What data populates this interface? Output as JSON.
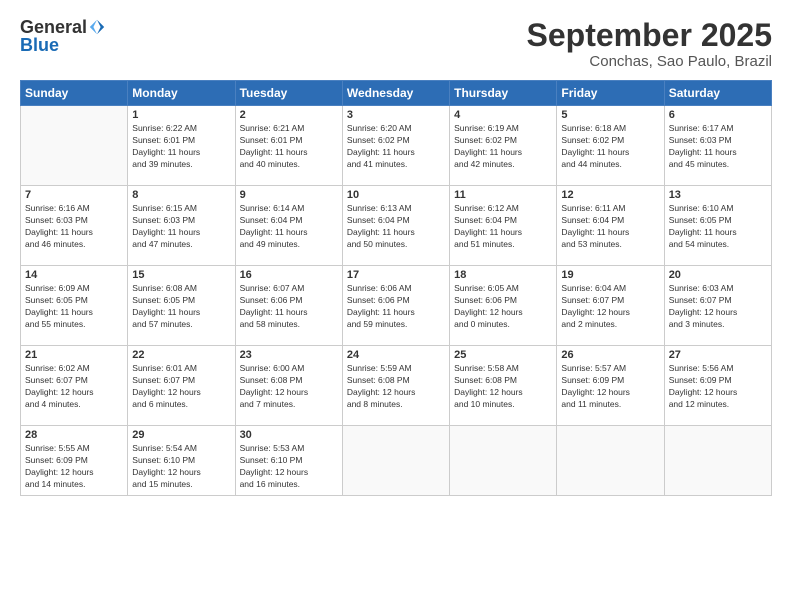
{
  "header": {
    "logo_general": "General",
    "logo_blue": "Blue",
    "month_title": "September 2025",
    "location": "Conchas, Sao Paulo, Brazil"
  },
  "days_of_week": [
    "Sunday",
    "Monday",
    "Tuesday",
    "Wednesday",
    "Thursday",
    "Friday",
    "Saturday"
  ],
  "weeks": [
    [
      {
        "day": "",
        "content": ""
      },
      {
        "day": "1",
        "content": "Sunrise: 6:22 AM\nSunset: 6:01 PM\nDaylight: 11 hours\nand 39 minutes."
      },
      {
        "day": "2",
        "content": "Sunrise: 6:21 AM\nSunset: 6:01 PM\nDaylight: 11 hours\nand 40 minutes."
      },
      {
        "day": "3",
        "content": "Sunrise: 6:20 AM\nSunset: 6:02 PM\nDaylight: 11 hours\nand 41 minutes."
      },
      {
        "day": "4",
        "content": "Sunrise: 6:19 AM\nSunset: 6:02 PM\nDaylight: 11 hours\nand 42 minutes."
      },
      {
        "day": "5",
        "content": "Sunrise: 6:18 AM\nSunset: 6:02 PM\nDaylight: 11 hours\nand 44 minutes."
      },
      {
        "day": "6",
        "content": "Sunrise: 6:17 AM\nSunset: 6:03 PM\nDaylight: 11 hours\nand 45 minutes."
      }
    ],
    [
      {
        "day": "7",
        "content": "Sunrise: 6:16 AM\nSunset: 6:03 PM\nDaylight: 11 hours\nand 46 minutes."
      },
      {
        "day": "8",
        "content": "Sunrise: 6:15 AM\nSunset: 6:03 PM\nDaylight: 11 hours\nand 47 minutes."
      },
      {
        "day": "9",
        "content": "Sunrise: 6:14 AM\nSunset: 6:04 PM\nDaylight: 11 hours\nand 49 minutes."
      },
      {
        "day": "10",
        "content": "Sunrise: 6:13 AM\nSunset: 6:04 PM\nDaylight: 11 hours\nand 50 minutes."
      },
      {
        "day": "11",
        "content": "Sunrise: 6:12 AM\nSunset: 6:04 PM\nDaylight: 11 hours\nand 51 minutes."
      },
      {
        "day": "12",
        "content": "Sunrise: 6:11 AM\nSunset: 6:04 PM\nDaylight: 11 hours\nand 53 minutes."
      },
      {
        "day": "13",
        "content": "Sunrise: 6:10 AM\nSunset: 6:05 PM\nDaylight: 11 hours\nand 54 minutes."
      }
    ],
    [
      {
        "day": "14",
        "content": "Sunrise: 6:09 AM\nSunset: 6:05 PM\nDaylight: 11 hours\nand 55 minutes."
      },
      {
        "day": "15",
        "content": "Sunrise: 6:08 AM\nSunset: 6:05 PM\nDaylight: 11 hours\nand 57 minutes."
      },
      {
        "day": "16",
        "content": "Sunrise: 6:07 AM\nSunset: 6:06 PM\nDaylight: 11 hours\nand 58 minutes."
      },
      {
        "day": "17",
        "content": "Sunrise: 6:06 AM\nSunset: 6:06 PM\nDaylight: 11 hours\nand 59 minutes."
      },
      {
        "day": "18",
        "content": "Sunrise: 6:05 AM\nSunset: 6:06 PM\nDaylight: 12 hours\nand 0 minutes."
      },
      {
        "day": "19",
        "content": "Sunrise: 6:04 AM\nSunset: 6:07 PM\nDaylight: 12 hours\nand 2 minutes."
      },
      {
        "day": "20",
        "content": "Sunrise: 6:03 AM\nSunset: 6:07 PM\nDaylight: 12 hours\nand 3 minutes."
      }
    ],
    [
      {
        "day": "21",
        "content": "Sunrise: 6:02 AM\nSunset: 6:07 PM\nDaylight: 12 hours\nand 4 minutes."
      },
      {
        "day": "22",
        "content": "Sunrise: 6:01 AM\nSunset: 6:07 PM\nDaylight: 12 hours\nand 6 minutes."
      },
      {
        "day": "23",
        "content": "Sunrise: 6:00 AM\nSunset: 6:08 PM\nDaylight: 12 hours\nand 7 minutes."
      },
      {
        "day": "24",
        "content": "Sunrise: 5:59 AM\nSunset: 6:08 PM\nDaylight: 12 hours\nand 8 minutes."
      },
      {
        "day": "25",
        "content": "Sunrise: 5:58 AM\nSunset: 6:08 PM\nDaylight: 12 hours\nand 10 minutes."
      },
      {
        "day": "26",
        "content": "Sunrise: 5:57 AM\nSunset: 6:09 PM\nDaylight: 12 hours\nand 11 minutes."
      },
      {
        "day": "27",
        "content": "Sunrise: 5:56 AM\nSunset: 6:09 PM\nDaylight: 12 hours\nand 12 minutes."
      }
    ],
    [
      {
        "day": "28",
        "content": "Sunrise: 5:55 AM\nSunset: 6:09 PM\nDaylight: 12 hours\nand 14 minutes."
      },
      {
        "day": "29",
        "content": "Sunrise: 5:54 AM\nSunset: 6:10 PM\nDaylight: 12 hours\nand 15 minutes."
      },
      {
        "day": "30",
        "content": "Sunrise: 5:53 AM\nSunset: 6:10 PM\nDaylight: 12 hours\nand 16 minutes."
      },
      {
        "day": "",
        "content": ""
      },
      {
        "day": "",
        "content": ""
      },
      {
        "day": "",
        "content": ""
      },
      {
        "day": "",
        "content": ""
      }
    ]
  ]
}
